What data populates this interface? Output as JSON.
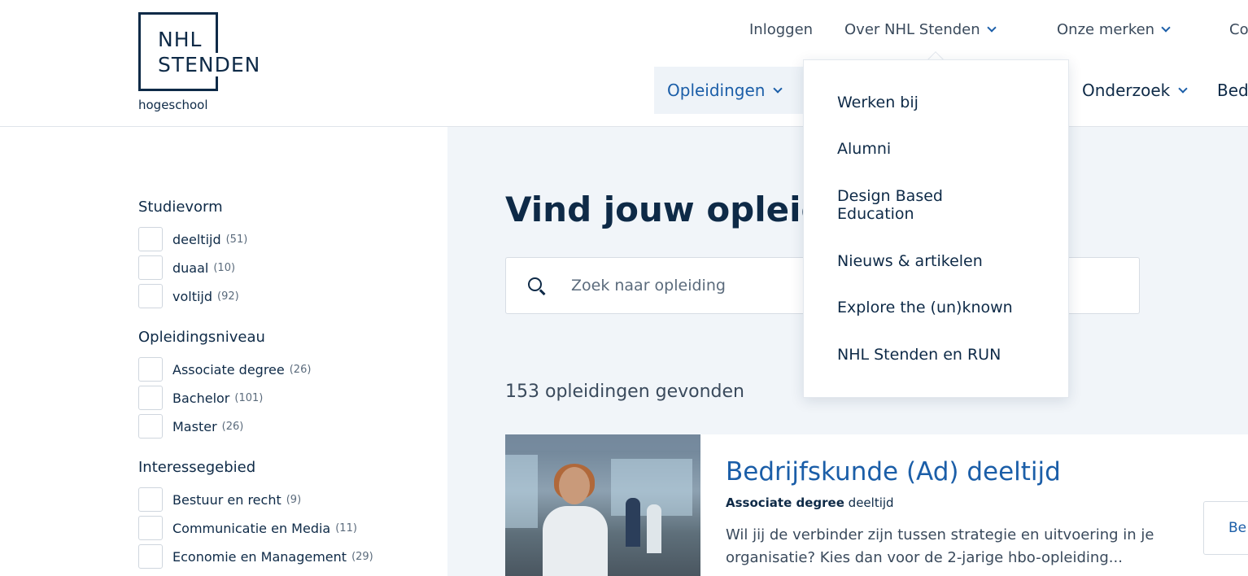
{
  "logo": {
    "line1": "NHL",
    "line2": "STENDEN",
    "subtitle": "hogeschool"
  },
  "topnav": {
    "login": "Inloggen",
    "about": "Over NHL Stenden",
    "brands": "Onze merken",
    "contact_partial": "Co"
  },
  "mainnav": {
    "opleidingen": "Opleidingen",
    "onderzoek": "Onderzoek",
    "partial": "Bed"
  },
  "dropdown": {
    "items": [
      "Werken bij",
      "Alumni",
      "Design Based Education",
      "Nieuws & artikelen",
      "Explore the (un)known",
      "NHL Stenden en RUN"
    ]
  },
  "filters": {
    "studievorm": {
      "title": "Studievorm",
      "options": [
        {
          "label": "deeltijd",
          "count": "(51)"
        },
        {
          "label": "duaal",
          "count": "(10)"
        },
        {
          "label": "voltijd",
          "count": "(92)"
        }
      ]
    },
    "niveau": {
      "title": "Opleidingsniveau",
      "options": [
        {
          "label": "Associate degree",
          "count": "(26)"
        },
        {
          "label": "Bachelor",
          "count": "(101)"
        },
        {
          "label": "Master",
          "count": "(26)"
        }
      ]
    },
    "interesse": {
      "title": "Interessegebied",
      "options": [
        {
          "label": "Bestuur en recht",
          "count": "(9)"
        },
        {
          "label": "Communicatie en Media",
          "count": "(11)"
        },
        {
          "label": "Economie en Management",
          "count": "(29)"
        }
      ]
    }
  },
  "main": {
    "title": "Vind jouw opleidi",
    "search_placeholder": "Zoek naar opleiding",
    "results": "153 opleidingen gevonden"
  },
  "card": {
    "title": "Bedrijfskunde (Ad) deeltijd",
    "level": "Associate degree",
    "form": "deeltijd",
    "description_line1": "Wil jij de verbinder zijn tussen strategie en uitvoering in je",
    "description_line2": "organisatie? Kies dan voor de 2-jarige hbo-opleiding...",
    "button_partial": "Be"
  },
  "colors": {
    "navy": "#0e2a47",
    "blue": "#1b5ea8",
    "panel": "#f1f5f9"
  }
}
